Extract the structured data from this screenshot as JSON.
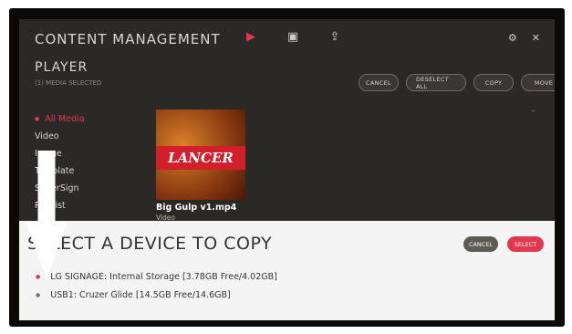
{
  "header": {
    "title": "CONTENT MANAGEMENT",
    "icons": [
      "video-icon",
      "usb-storage-icon",
      "export-icon"
    ],
    "controls": [
      "settings-icon",
      "close-icon"
    ]
  },
  "section": {
    "title": "PLAYER",
    "selection": "(1) MEDIA SELECTED"
  },
  "actions": {
    "cancel": "CANCEL",
    "deselect_all": "DESELECT ALL",
    "copy": "COPY",
    "move": "MOVE"
  },
  "menu": {
    "items": [
      "All Media",
      "Video",
      "Image",
      "Template",
      "SuperSign",
      "Playlist"
    ]
  },
  "media": {
    "thumbnail_text": "LANCER",
    "name": "Big Gulp v1.mp4",
    "type": "Video"
  },
  "dialog": {
    "title": "SELECT A DEVICE TO COPY",
    "cancel": "CANCEL",
    "select": "SELECT",
    "devices": [
      "LG SIGNAGE: Internal Storage [3.78GB Free/4.02GB]",
      "USB1: Cruzer Glide [14.5GB Free/14.6GB]"
    ]
  },
  "colors": {
    "accent": "#e0384f",
    "panel": "#2b2925",
    "dialog": "#f4f4f4"
  }
}
